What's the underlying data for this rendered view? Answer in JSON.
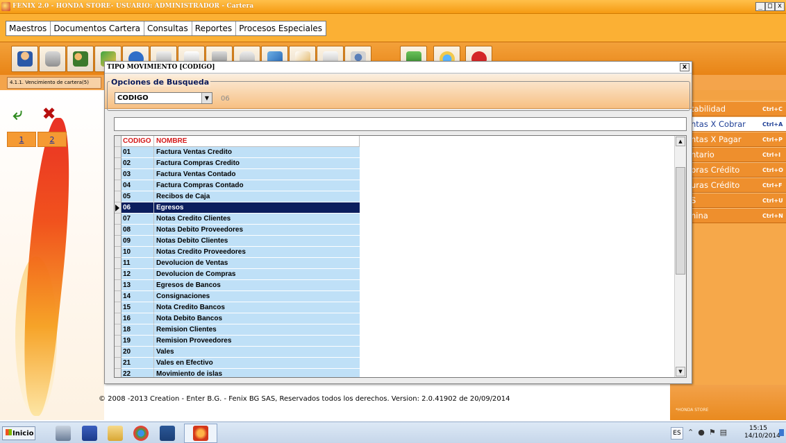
{
  "window": {
    "title": "FENIX 2.0 - HONDA STORE- USUARIO: ADMINISTRADOR - Cartera",
    "buttons": [
      "_",
      "□",
      "x"
    ]
  },
  "menubar": {
    "items": [
      "Maestros",
      "Documentos Cartera",
      "Consultas",
      "Reportes",
      "Procesos Especiales"
    ]
  },
  "toolbar": {
    "icons": [
      "user-icon",
      "disk-icon",
      "network-users-icon",
      "refresh-folder-icon",
      "help-icon",
      "printer-icon",
      "printer-paper-icon",
      "shield-icon",
      "lock-icon",
      "document-icon",
      "edit-icon",
      "save-icon",
      "users-group-icon",
      "download-icon",
      "internet-explorer-icon",
      "close-red-icon"
    ]
  },
  "statusbar": {
    "breadcrumb": "4.1.1. Vencimiento de cartera(5)"
  },
  "leftpanel": {
    "tabs": [
      "1",
      "2"
    ]
  },
  "rightpanel": {
    "items": [
      {
        "label": "tabilidad",
        "shortcut": "Ctrl+C"
      },
      {
        "label": "ntas X Cobrar",
        "shortcut": "Ctrl+A",
        "selected": true
      },
      {
        "label": "ntas X Pagar",
        "shortcut": "Ctrl+P"
      },
      {
        "label": "ntario",
        "shortcut": "Ctrl+I"
      },
      {
        "label": "pras  Crédito",
        "shortcut": "Ctrl+O"
      },
      {
        "label": "uras  Crédito",
        "shortcut": "Ctrl+F"
      },
      {
        "label": "S",
        "shortcut": "Ctrl+U"
      },
      {
        "label": "nina",
        "shortcut": "Ctrl+N"
      }
    ],
    "brand": "*HONDA STORE"
  },
  "dialog": {
    "title": "TIPO MOVIMIENTO [CODIGO]",
    "close_label": "x",
    "search_group_label": "Opciones de Busqueda",
    "search_field": "CODIGO",
    "current_code": "06",
    "filter_value": "",
    "columns": [
      "CODIGO",
      "NOMBRE"
    ],
    "selected_index": 5,
    "rows": [
      [
        "01",
        "Factura Ventas Credito"
      ],
      [
        "02",
        "Factura Compras Credito"
      ],
      [
        "03",
        "Factura Ventas Contado"
      ],
      [
        "04",
        "Factura Compras Contado"
      ],
      [
        "05",
        "Recibos de Caja"
      ],
      [
        "06",
        "Egresos"
      ],
      [
        "07",
        "Notas Credito Clientes"
      ],
      [
        "08",
        "Notas Debito Proveedores"
      ],
      [
        "09",
        "Notas Debito Clientes"
      ],
      [
        "10",
        "Notas Credito Proveedores"
      ],
      [
        "11",
        "Devolucion de Ventas"
      ],
      [
        "12",
        "Devolucion de Compras"
      ],
      [
        "13",
        "Egresos de Bancos"
      ],
      [
        "14",
        "Consignaciones"
      ],
      [
        "15",
        "Nota Credito Bancos"
      ],
      [
        "16",
        "Nota Debito Bancos"
      ],
      [
        "18",
        "Remision Clientes"
      ],
      [
        "19",
        "Remision Proveedores"
      ],
      [
        "20",
        "Vales"
      ],
      [
        "21",
        "Vales en Efectivo"
      ],
      [
        "22",
        "Movimiento de islas"
      ]
    ]
  },
  "footer": {
    "copyright": "© 2008 -2013 Creation - Enter B.G. - Fenix BG SAS, Reservados todos los derechos.   Version: 2.0.41902 de 20/09/2014"
  },
  "taskbar": {
    "start_label": "Inicio",
    "language": "ES",
    "time": "15:15",
    "date": "14/10/2014"
  }
}
